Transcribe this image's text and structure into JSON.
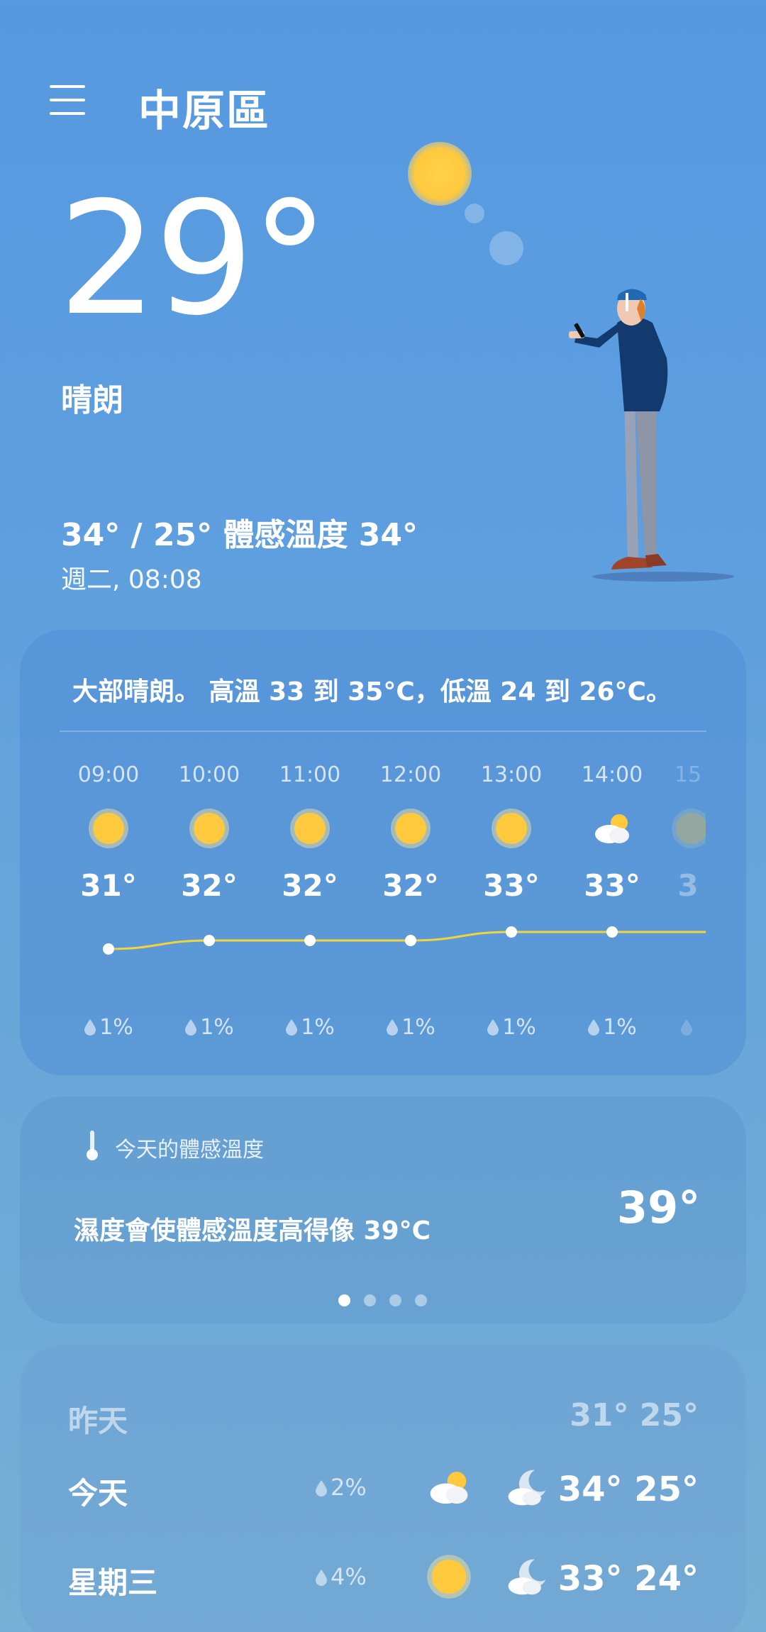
{
  "header": {
    "location": "中原區"
  },
  "current": {
    "temperature": "29°",
    "condition": "晴朗",
    "high_low_feels": "34° / 25° 體感溫度 34°",
    "datetime": "週二, 08:08"
  },
  "hourly": {
    "summary": "大部晴朗。 高溫 33 到 35°C，低溫 24 到 26°C。",
    "items": [
      {
        "time": "09:00",
        "icon": "sun-icon",
        "temp": "31°",
        "rain": "1%"
      },
      {
        "time": "10:00",
        "icon": "sun-icon",
        "temp": "32°",
        "rain": "1%"
      },
      {
        "time": "11:00",
        "icon": "sun-icon",
        "temp": "32°",
        "rain": "1%"
      },
      {
        "time": "12:00",
        "icon": "sun-icon",
        "temp": "32°",
        "rain": "1%"
      },
      {
        "time": "13:00",
        "icon": "sun-icon",
        "temp": "33°",
        "rain": "1%"
      },
      {
        "time": "14:00",
        "icon": "partly-cloudy-icon",
        "temp": "33°",
        "rain": "1%"
      },
      {
        "time": "15",
        "icon": "sun-icon",
        "temp": "3",
        "rain": ""
      }
    ]
  },
  "feels_like": {
    "title": "今天的體感溫度",
    "description": "濕度會使體感溫度高得像 39°C",
    "value": "39°",
    "page_count": 4,
    "active_page": 0
  },
  "daily": [
    {
      "day": "昨天",
      "rain": "",
      "temps": "31° 25°",
      "past": true
    },
    {
      "day": "今天",
      "rain": "2%",
      "day_icon": "partly-cloudy-icon",
      "night_icon": "cloudy-night-icon",
      "temps": "34° 25°"
    },
    {
      "day": "星期三",
      "rain": "4%",
      "day_icon": "sun-icon",
      "night_icon": "cloudy-night-icon",
      "temps": "33° 24°"
    }
  ],
  "colors": {
    "sun": "#ffc93d",
    "temp_line": "#f2d33b"
  }
}
